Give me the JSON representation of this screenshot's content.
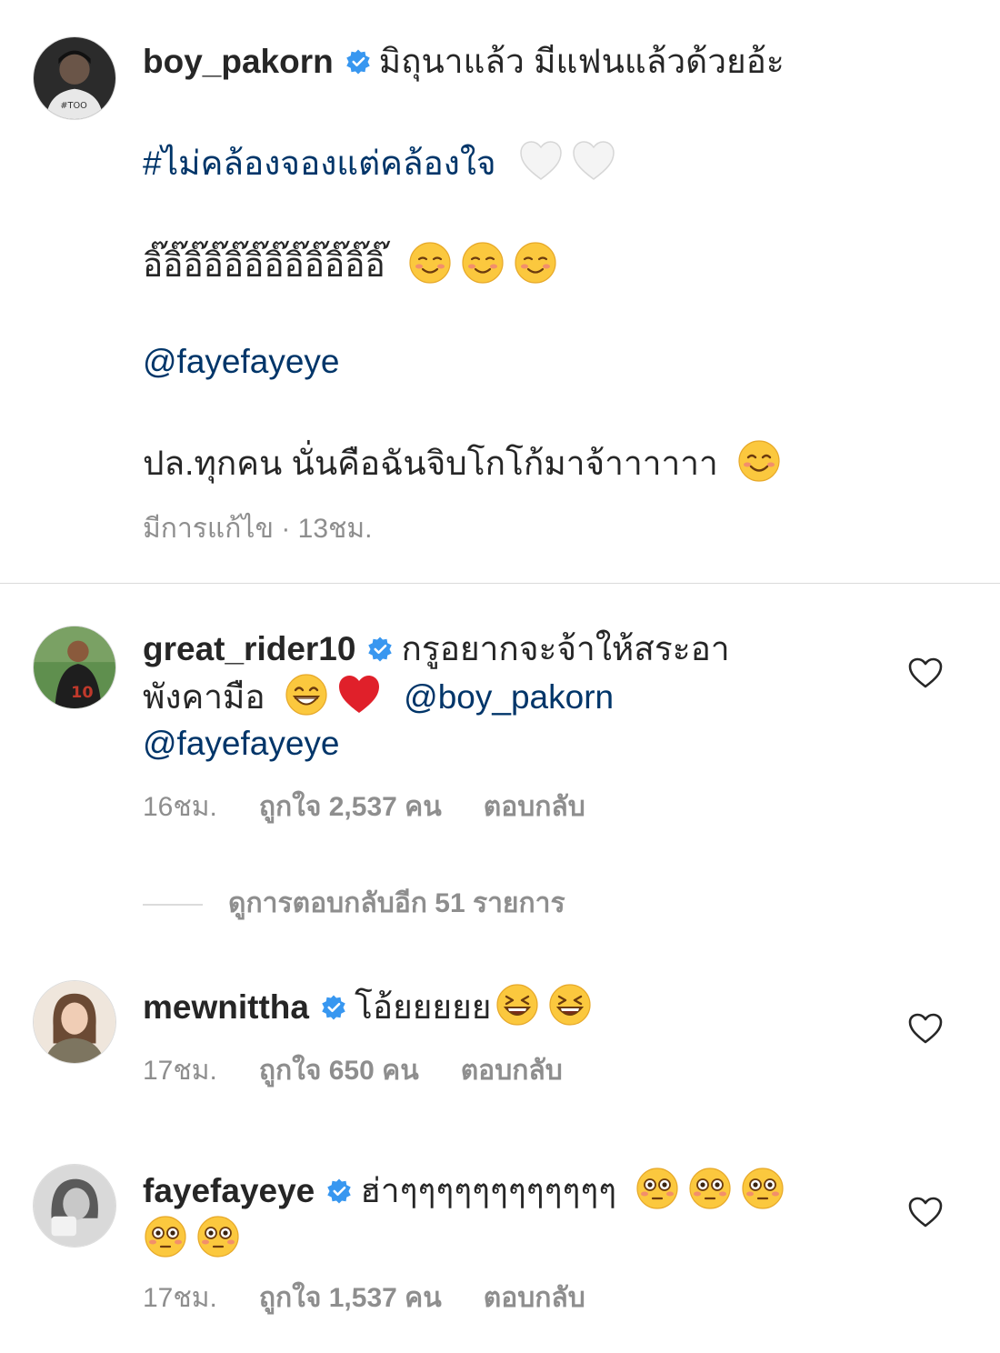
{
  "caption": {
    "username": "boy_pakorn",
    "line1": "มิถุนาแล้ว มีแฟนแล้วด้วยอ้ะ",
    "hashtag": "#ไม่คล้องจองแต่คล้องใจ",
    "line3": "อิ๊อิ๊อิ๊อิ๊อิ๊อิ๊อิ๊อิ๊อิ๊อิ๊อิ๊อิ๊",
    "mention": "@fayefayeye",
    "line5": "ปล.ทุกคน นั่นคือฉันจิบโกโก้มาจ้าาาาาา",
    "meta": "มีการแก้ไข · 13ชม."
  },
  "comments": [
    {
      "username": "great_rider10",
      "text1": "กรูอยากจะจ้าให้สระอา",
      "text2": "พังคามือ",
      "mention1": "@boy_pakorn",
      "mention2": "@fayefayeye",
      "time": "16ชม.",
      "likes": "ถูกใจ 2,537 คน",
      "reply": "ตอบกลับ"
    },
    {
      "username": "mewnittha",
      "text1": "โอ้ยยยยย",
      "time": "17ชม.",
      "likes": "ถูกใจ 650 คน",
      "reply": "ตอบกลับ"
    },
    {
      "username": "fayefayeye",
      "text1": "ฮ่าๆๆๆๆๆๆๆๆๆๆๆๆ",
      "time": "17ชม.",
      "likes": "ถูกใจ 1,537 คน",
      "reply": "ตอบกลับ"
    }
  ],
  "view_replies": "ดูการตอบกลับอีก 51 รายการ",
  "icons": {
    "verified": "verified-badge-icon",
    "heart": "heart-outline-icon",
    "emoji_white_heart": "white-heart-emoji",
    "emoji_smile": "smiling-face-emoji",
    "emoji_blush": "blushing-smile-emoji",
    "emoji_grin": "grinning-face-emoji",
    "emoji_red_heart": "red-heart-emoji",
    "emoji_laugh": "laughing-squint-emoji",
    "emoji_flushed": "flushed-face-emoji"
  },
  "colors": {
    "text": "#262626",
    "muted": "#8e8e8e",
    "link": "#003569",
    "verified": "#3897f0",
    "divider": "#dbdbdb"
  }
}
